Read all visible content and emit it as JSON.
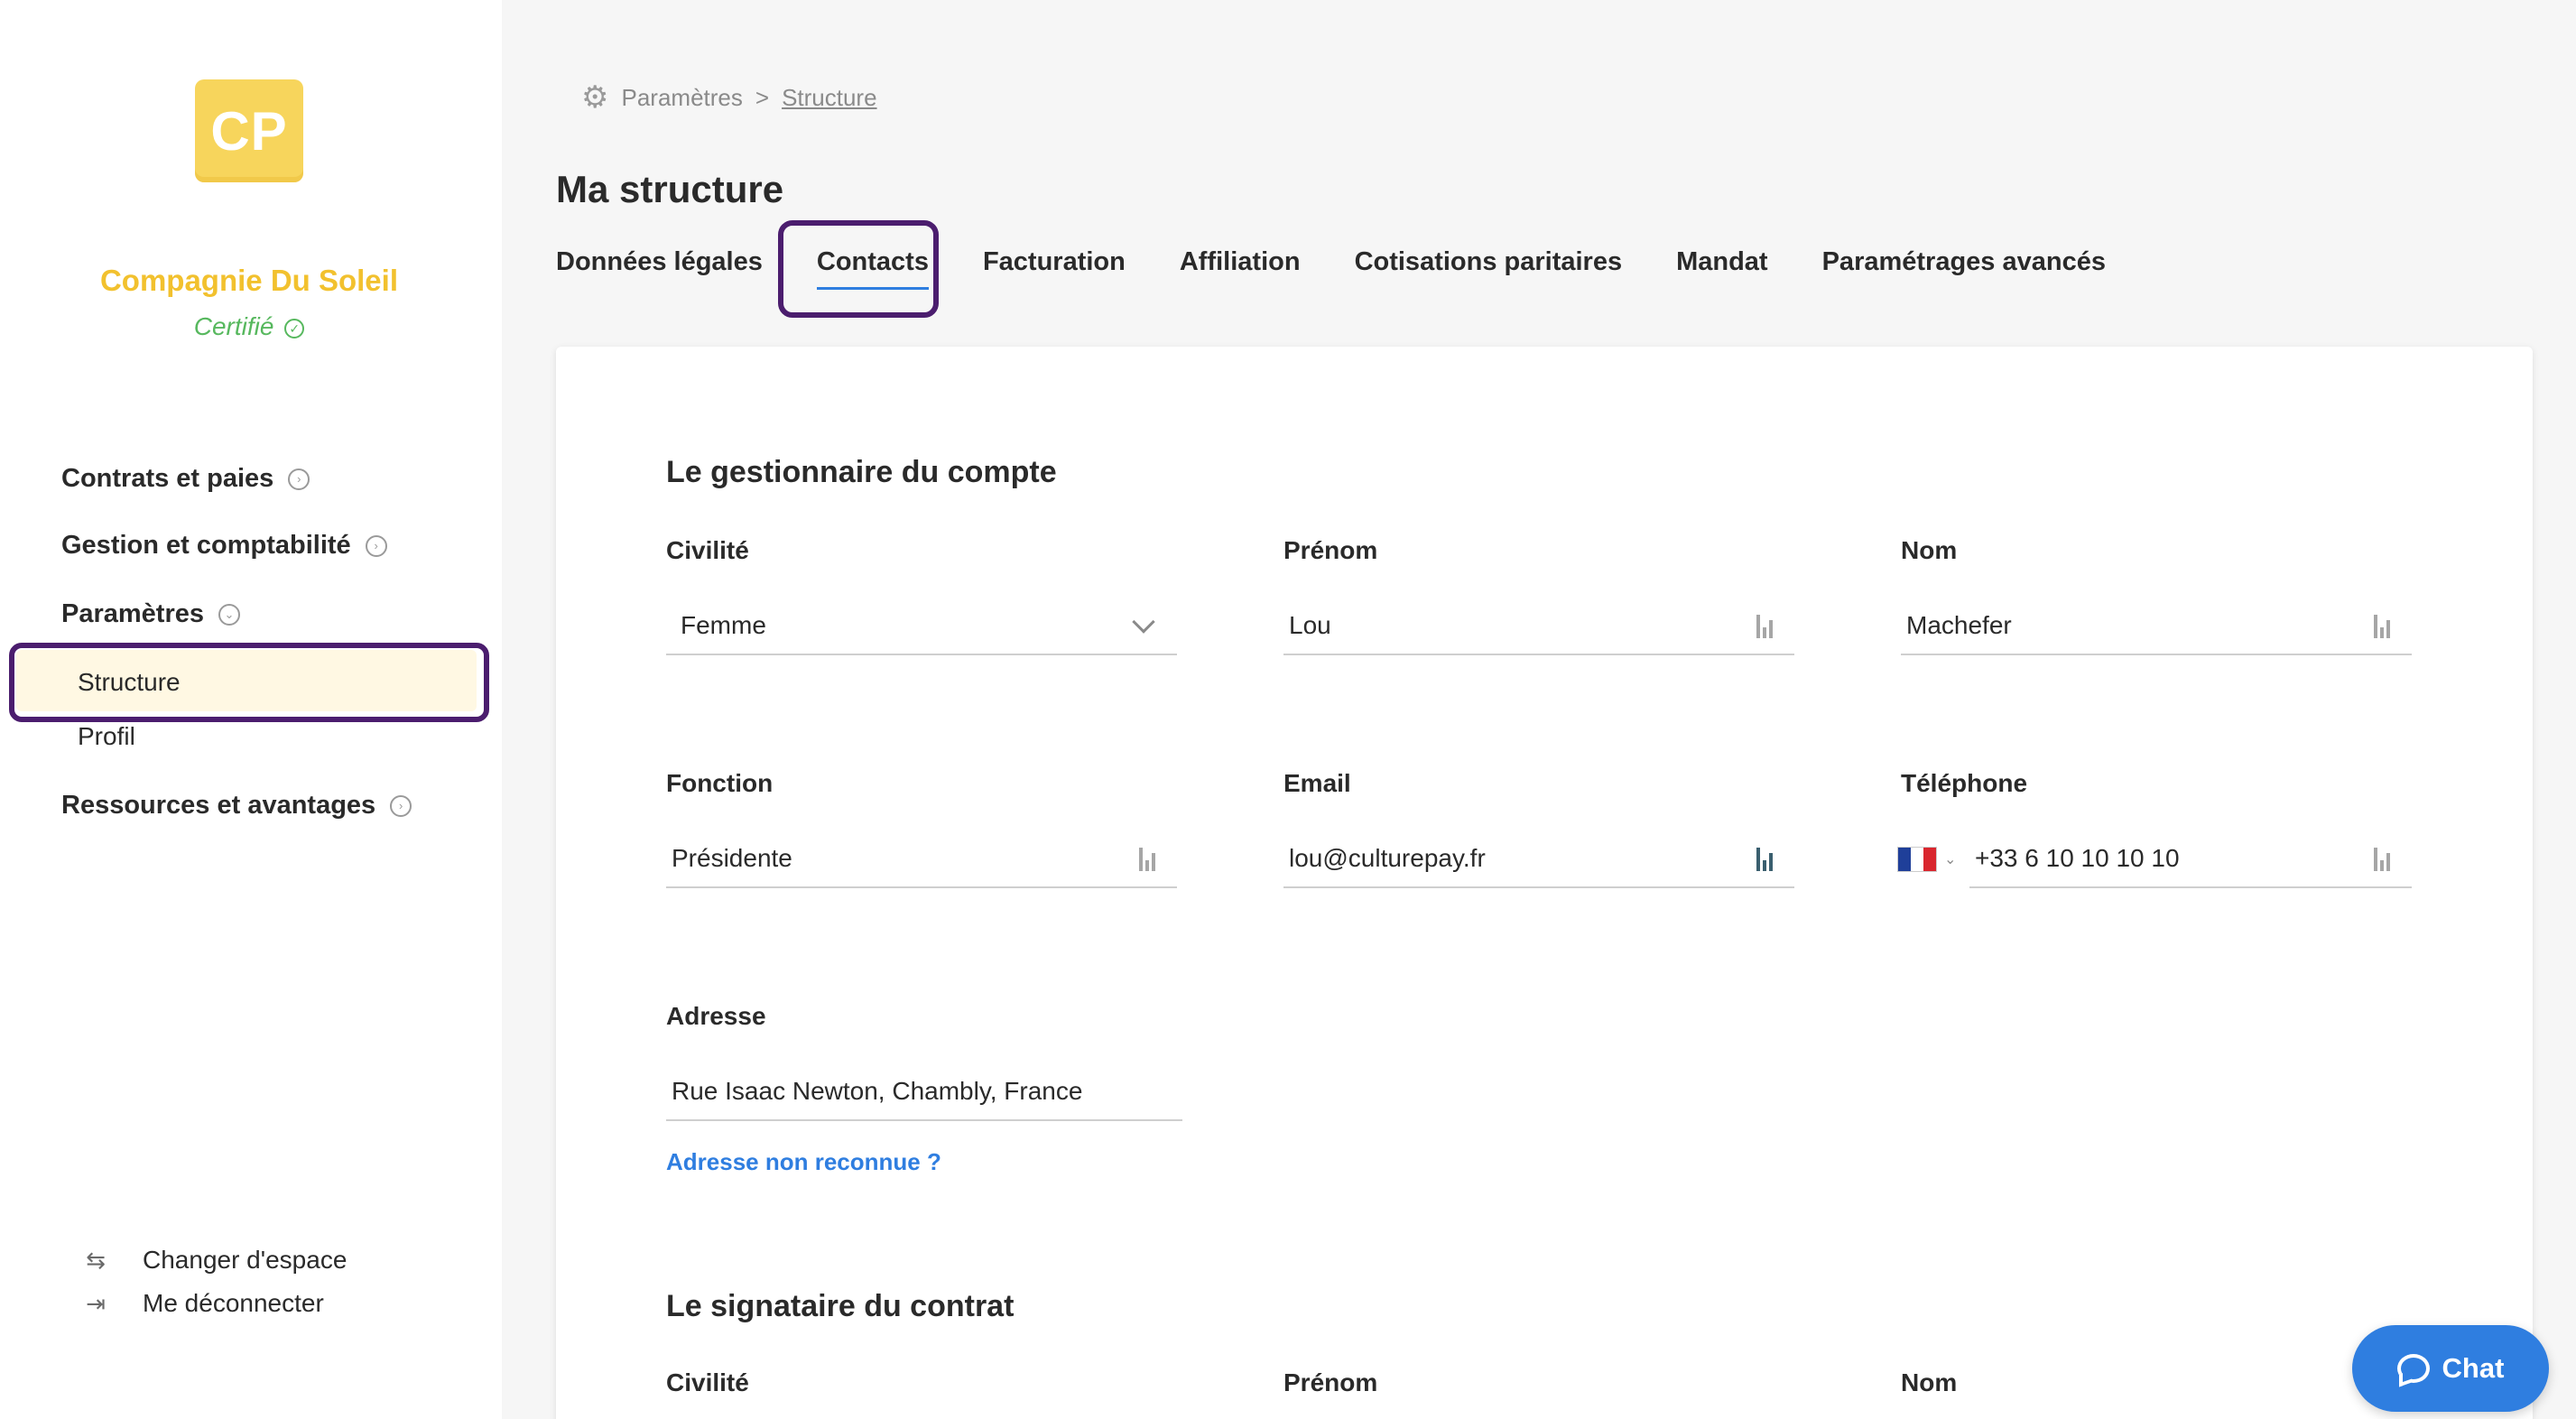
{
  "sidebar": {
    "logo_text": "CP",
    "company_name": "Compagnie Du Soleil",
    "certified_label": "Certifié",
    "nav": [
      {
        "label": "Contrats et paies"
      },
      {
        "label": "Gestion et comptabilité"
      },
      {
        "label": "Paramètres",
        "children": [
          {
            "label": "Structure",
            "selected": true
          },
          {
            "label": "Profil"
          }
        ]
      },
      {
        "label": "Ressources et avantages"
      }
    ],
    "switch_space": "Changer d'espace",
    "logout": "Me déconnecter"
  },
  "breadcrumb": {
    "root": "Paramètres",
    "separator": ">",
    "current": "Structure"
  },
  "page": {
    "title": "Ma structure",
    "tabs": [
      {
        "label": "Données légales"
      },
      {
        "label": "Contacts",
        "active": true
      },
      {
        "label": "Facturation"
      },
      {
        "label": "Affiliation"
      },
      {
        "label": "Cotisations paritaires"
      },
      {
        "label": "Mandat"
      },
      {
        "label": "Paramétrages avancés"
      }
    ]
  },
  "manager": {
    "title": "Le gestionnaire du compte",
    "civility_label": "Civilité",
    "civility_value": "Femme",
    "firstname_label": "Prénom",
    "firstname_value": "Lou",
    "lastname_label": "Nom",
    "lastname_value": "Machefer",
    "function_label": "Fonction",
    "function_value": "Présidente",
    "email_label": "Email",
    "email_value": "lou@culturepay.fr",
    "phone_label": "Téléphone",
    "phone_value": "+33 6 10 10 10 10",
    "address_label": "Adresse",
    "address_value": "Rue Isaac Newton, Chambly, France",
    "address_unrecognized": "Adresse non reconnue ?"
  },
  "signatory": {
    "title": "Le signataire du contrat",
    "civility_label": "Civilité",
    "firstname_label": "Prénom",
    "lastname_label": "Nom"
  },
  "chat": {
    "label": "Chat"
  },
  "colors": {
    "accent": "#2f7ee0",
    "brand_yellow": "#f2c12e",
    "certified_green": "#57b85e",
    "highlight_outline": "#4b1d6e"
  }
}
